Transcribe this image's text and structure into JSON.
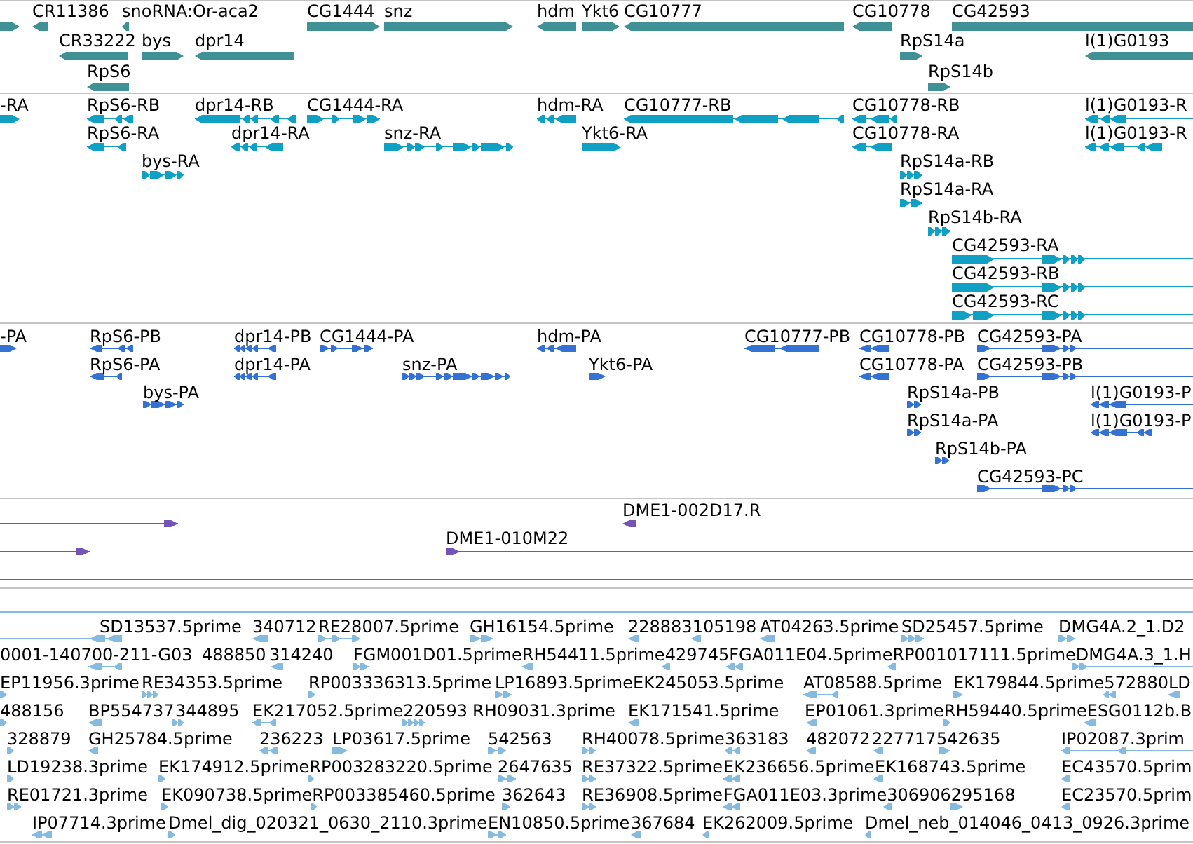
{
  "tracks": [
    {
      "color": "#3f9195",
      "features": [
        {
          "reverse": false
        },
        {
          "label": "CR11386",
          "reverse": true
        },
        {
          "label": "snoRNA:Or-aca2",
          "reverse": true
        },
        {
          "label": "CG1444",
          "reverse": false
        },
        {
          "label": "snz",
          "reverse": false
        },
        {
          "label": "hdm",
          "reverse": true
        },
        {
          "label": "Ykt6",
          "reverse": false
        },
        {
          "label": "CG10777",
          "reverse": true
        },
        {
          "label": "CG10778",
          "reverse": true
        },
        {
          "label": "CG42593",
          "reverse": false
        },
        {
          "label": "CR33222",
          "reverse": true
        },
        {
          "label": "bys",
          "reverse": false
        },
        {
          "label": "dpr14",
          "reverse": true
        },
        {
          "label": "RpS14a",
          "reverse": false
        },
        {
          "label": "l(1)G0193",
          "reverse": true
        },
        {
          "label": "RpS6",
          "reverse": true
        },
        {
          "label": "RpS14b",
          "reverse": false
        }
      ]
    },
    {
      "color": "#0fa0c3",
      "features": [
        {
          "label": "-RA",
          "reverse": false
        },
        {
          "label": "RpS6-RB",
          "reverse": true
        },
        {
          "label": "dpr14-RB",
          "reverse": true
        },
        {
          "label": "CG1444-RA",
          "reverse": false
        },
        {
          "label": "hdm-RA",
          "reverse": true
        },
        {
          "label": "CG10777-RB",
          "reverse": true
        },
        {
          "label": "CG10778-RB",
          "reverse": true
        },
        {
          "label": "l(1)G0193-R",
          "reverse": true
        },
        {
          "label": "RpS6-RA",
          "reverse": true
        },
        {
          "label": "dpr14-RA",
          "reverse": true
        },
        {
          "label": "snz-RA",
          "reverse": false
        },
        {
          "label": "Ykt6-RA",
          "reverse": false
        },
        {
          "label": "CG10778-RA",
          "reverse": true
        },
        {
          "label": "l(1)G0193-R",
          "reverse": true
        },
        {
          "label": "bys-RA",
          "reverse": false
        },
        {
          "label": "RpS14a-RB",
          "reverse": false
        },
        {
          "label": "RpS14a-RA",
          "reverse": false
        },
        {
          "label": "RpS14b-RA",
          "reverse": false
        },
        {
          "label": "CG42593-RA",
          "reverse": false
        },
        {
          "label": "CG42593-RB",
          "reverse": false
        },
        {
          "label": "CG42593-RC",
          "reverse": false
        }
      ]
    },
    {
      "color": "#3371d2",
      "features": [
        {
          "label": "-PA",
          "reverse": false
        },
        {
          "label": "RpS6-PB",
          "reverse": true
        },
        {
          "label": "dpr14-PB",
          "reverse": true
        },
        {
          "label": "CG1444-PA",
          "reverse": false
        },
        {
          "label": "hdm-PA",
          "reverse": true
        },
        {
          "label": "CG10777-PB",
          "reverse": true
        },
        {
          "label": "CG10778-PB",
          "reverse": true
        },
        {
          "label": "CG42593-PA",
          "reverse": false
        },
        {
          "label": "RpS6-PA",
          "reverse": true
        },
        {
          "label": "dpr14-PA",
          "reverse": true
        },
        {
          "label": "snz-PA",
          "reverse": false
        },
        {
          "label": "Ykt6-PA",
          "reverse": false
        },
        {
          "label": "CG10778-PA",
          "reverse": true
        },
        {
          "label": "CG42593-PB",
          "reverse": false
        },
        {
          "label": "bys-PA",
          "reverse": false
        },
        {
          "label": "RpS14a-PB",
          "reverse": false
        },
        {
          "label": "l(1)G0193-P",
          "reverse": true
        },
        {
          "label": "RpS14a-PA",
          "reverse": false
        },
        {
          "label": "l(1)G0193-P",
          "reverse": true
        },
        {
          "label": "RpS14b-PA",
          "reverse": false
        },
        {
          "label": "CG42593-PC",
          "reverse": false
        }
      ]
    },
    {
      "color": "#7353b3",
      "features": [
        {
          "reverse": false
        },
        {
          "label": "DME1-002D17.R",
          "reverse": true
        },
        {
          "reverse": false
        },
        {
          "label": "DME1-010M22",
          "reverse": false
        }
      ]
    },
    {
      "color": "#85bae1",
      "features": [
        {
          "label": "SD13537.5prime",
          "reverse": true
        },
        {
          "label": "340712",
          "reverse": true
        },
        {
          "label": "RE28007.5prime",
          "reverse": false
        },
        {
          "label": "GH16154.5prime",
          "reverse": false
        },
        {
          "label": "228883",
          "reverse": true
        },
        {
          "label": "105198",
          "reverse": true
        },
        {
          "label": "AT04263.5prime",
          "reverse": true
        },
        {
          "label": "SD25457.5prime",
          "reverse": false
        },
        {
          "label": "DMG4A.2_1.D2",
          "reverse": false
        },
        {
          "label": "0001-140700-211-G03",
          "reverse": true
        },
        {
          "label": "488850"
        },
        {
          "label": "314240",
          "reverse": true
        },
        {
          "label": "FGM001D01.5prime",
          "reverse": false
        },
        {
          "label": "RH54411.5prime",
          "reverse": true
        },
        {
          "label": "429745",
          "reverse": true
        },
        {
          "label": "FGA011E04.5prime",
          "reverse": true
        },
        {
          "label": "RP001017111.5prime",
          "reverse": true
        },
        {
          "label": "DMG4A.3_1.H",
          "reverse": false
        },
        {
          "label": "EP11956.3prime",
          "reverse": false
        },
        {
          "label": "RE34353.5prime",
          "reverse": false
        },
        {
          "label": "RP003336313.5prime",
          "reverse": false
        },
        {
          "label": "LP16893.5prime",
          "reverse": false
        },
        {
          "label": "EK245053.5prime"
        },
        {
          "label": "AT08588.5prime",
          "reverse": true
        },
        {
          "label": "EK179844.5prime",
          "reverse": false
        },
        {
          "label": "572880",
          "reverse": true
        },
        {
          "label": "LD",
          "reverse": true
        },
        {
          "label": "488156",
          "reverse": false
        },
        {
          "label": "BP554737",
          "reverse": true
        },
        {
          "label": "344895",
          "reverse": false
        },
        {
          "label": "EK217052.5prime",
          "reverse": true
        },
        {
          "label": "220593",
          "reverse": false
        },
        {
          "label": "RH09031.3prime"
        },
        {
          "label": "EK171541.5prime",
          "reverse": true
        },
        {
          "label": "EP01061.3prime",
          "reverse": true
        },
        {
          "label": "RH59440.5prime",
          "reverse": false
        },
        {
          "label": "ESG0112b.B",
          "reverse": true
        },
        {
          "label": "328879",
          "reverse": false
        },
        {
          "label": "GH25784.5prime",
          "reverse": true
        },
        {
          "label": "236223",
          "reverse": true
        },
        {
          "label": "LP03617.5prime",
          "reverse": false
        },
        {
          "label": "542563",
          "reverse": false
        },
        {
          "label": "RH40078.5prime",
          "reverse": false
        },
        {
          "label": "363183",
          "reverse": true
        },
        {
          "label": "482072",
          "reverse": true
        },
        {
          "label": "227717",
          "reverse": true
        },
        {
          "label": "542635",
          "reverse": false
        },
        {
          "label": "IP02087.3prim",
          "reverse": true
        },
        {
          "label": "LD19238.3prime",
          "reverse": false
        },
        {
          "label": "EK174912.5prime",
          "reverse": false
        },
        {
          "label": "RP003283220.5prime",
          "reverse": false
        },
        {
          "label": "2647635",
          "reverse": false
        },
        {
          "label": "RE37322.5prime",
          "reverse": false
        },
        {
          "label": "EK236656.5prime",
          "reverse": true
        },
        {
          "label": "EK168743.5prime",
          "reverse": true
        },
        {
          "label": "EC43570.5prim",
          "reverse": true
        },
        {
          "label": "RE01721.3prime",
          "reverse": false
        },
        {
          "label": "EK090738.5prime",
          "reverse": false
        },
        {
          "label": "RP003385460.5prime",
          "reverse": false
        },
        {
          "label": "362643",
          "reverse": false
        },
        {
          "label": "RE36908.5prime",
          "reverse": false
        },
        {
          "label": "FGA011E03.3prime",
          "reverse": true
        },
        {
          "label": "306906",
          "reverse": true
        },
        {
          "label": "295168",
          "reverse": false
        },
        {
          "label": "EC23570.5prim",
          "reverse": true
        },
        {
          "label": "IP07714.3prime",
          "reverse": true
        },
        {
          "label": "Dmel_dig_020321_0630_2110.3prime",
          "reverse": false
        },
        {
          "label": "EN10850.5prime",
          "reverse": false
        },
        {
          "label": "367684",
          "reverse": true
        },
        {
          "label": "EK262009.5prime",
          "reverse": true
        },
        {
          "label": "Dmel_neb_014046_0413_0926.3prime",
          "reverse": true
        }
      ]
    }
  ]
}
